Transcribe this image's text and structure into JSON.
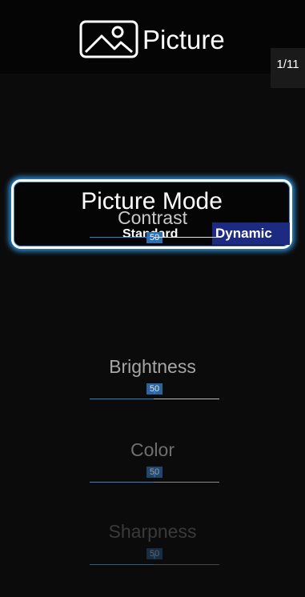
{
  "header": {
    "title": "Picture",
    "icon": "picture-icon",
    "page_counter": "1/11"
  },
  "picture_mode": {
    "label": "Picture Mode",
    "options": [
      "Standard",
      "Dynamic"
    ],
    "selected": "Dynamic",
    "left_option": "Standard",
    "right_option": "Dynamic"
  },
  "settings": [
    {
      "label": "Contrast",
      "value": "50"
    },
    {
      "label": "Brightness",
      "value": "50"
    },
    {
      "label": "Color",
      "value": "50"
    },
    {
      "label": "Sharpness",
      "value": "50"
    }
  ],
  "colors": {
    "accent": "#2d7dd2",
    "selected_option_bg": "#1d2a82",
    "focus_glow": "#2f8fd6"
  }
}
